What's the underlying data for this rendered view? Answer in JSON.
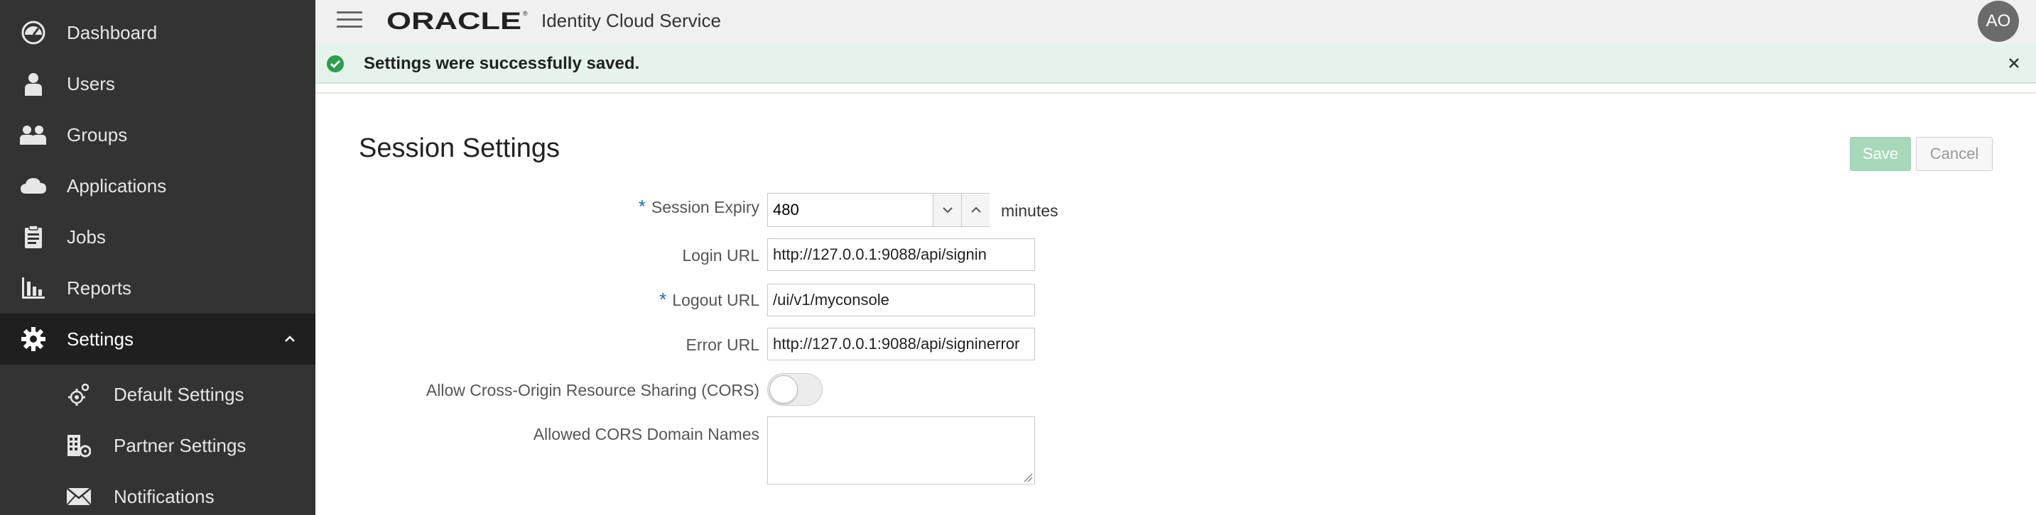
{
  "sidebar": {
    "items": [
      {
        "label": "Dashboard",
        "icon": "dashboard-icon"
      },
      {
        "label": "Users",
        "icon": "user-icon"
      },
      {
        "label": "Groups",
        "icon": "groups-icon"
      },
      {
        "label": "Applications",
        "icon": "cloud-icon"
      },
      {
        "label": "Jobs",
        "icon": "clipboard-icon"
      },
      {
        "label": "Reports",
        "icon": "bar-chart-icon"
      },
      {
        "label": "Settings",
        "icon": "gear-icon",
        "expanded": true
      }
    ],
    "sub_items": [
      {
        "label": "Default Settings",
        "icon": "gear-small-icon"
      },
      {
        "label": "Partner Settings",
        "icon": "building-icon"
      },
      {
        "label": "Notifications",
        "icon": "envelope-icon"
      }
    ]
  },
  "header": {
    "logo_text": "ORACLE",
    "product_name": "Identity Cloud Service",
    "avatar_initials": "AO"
  },
  "banner": {
    "message": "Settings were successfully saved."
  },
  "page": {
    "title": "Session Settings",
    "save_label": "Save",
    "cancel_label": "Cancel"
  },
  "form": {
    "session_expiry": {
      "label": "Session Expiry",
      "value": "480",
      "unit": "minutes",
      "required": true
    },
    "login_url": {
      "label": "Login URL",
      "value": "http://127.0.0.1:9088/api/signin"
    },
    "logout_url": {
      "label": "Logout URL",
      "value": "/ui/v1/myconsole",
      "required": true
    },
    "error_url": {
      "label": "Error URL",
      "value": "http://127.0.0.1:9088/api/signinerror"
    },
    "cors": {
      "label": "Allow Cross-Origin Resource Sharing (CORS)",
      "enabled": false
    },
    "cors_domains": {
      "label": "Allowed CORS Domain Names",
      "value": ""
    }
  },
  "colors": {
    "sidebar_bg": "#333333",
    "banner_bg": "#e5f3ec",
    "success_green": "#2e9e4f",
    "required_blue": "#1f6db6",
    "save_disabled": "#a6d8b9"
  }
}
